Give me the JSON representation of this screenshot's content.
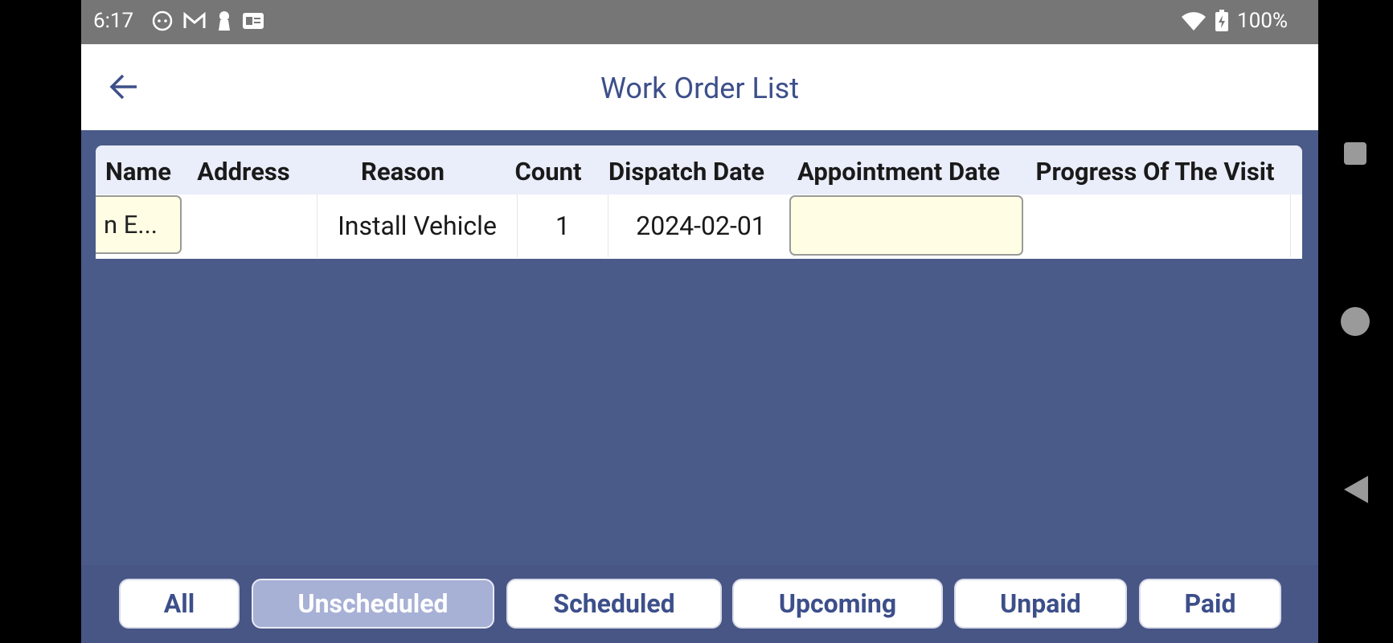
{
  "status_bar": {
    "time": "6:17",
    "battery": "100%"
  },
  "app_bar": {
    "title": "Work Order List"
  },
  "table": {
    "headers": [
      "Name",
      "Address",
      "Reason",
      "Count",
      "Dispatch Date",
      "Appointment Date",
      "Progress Of The Visit"
    ],
    "rows": [
      {
        "name": "n E...",
        "address": "",
        "reason": "Install Vehicle",
        "count": "1",
        "dispatch_date": "2024-02-01",
        "appointment_date": "",
        "progress": ""
      }
    ]
  },
  "filters": {
    "tabs": [
      "All",
      "Unscheduled",
      "Scheduled",
      "Upcoming",
      "Unpaid",
      "Paid"
    ],
    "active": "Unscheduled"
  },
  "colors": {
    "background": "#4a5a89",
    "accent": "#3d4f8a",
    "active_tab": "#a7b0d5",
    "input_fill": "#fffee4"
  }
}
